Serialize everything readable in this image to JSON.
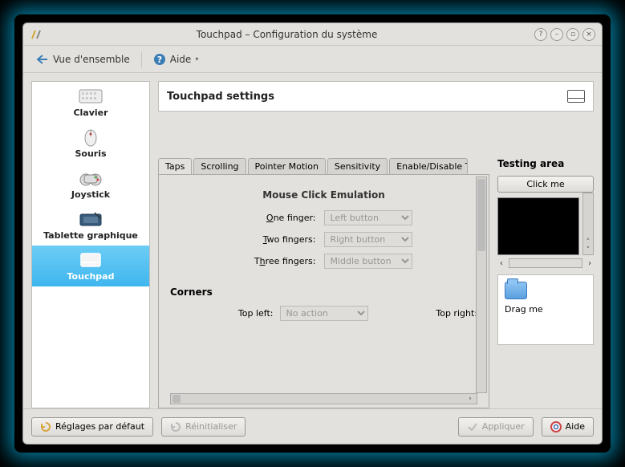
{
  "window": {
    "title": "Touchpad – Configuration du système"
  },
  "toolbar": {
    "overview": "Vue d'ensemble",
    "help": "Aide"
  },
  "sidebar": {
    "items": [
      {
        "label": "Clavier"
      },
      {
        "label": "Souris"
      },
      {
        "label": "Joystick"
      },
      {
        "label": "Tablette graphique"
      },
      {
        "label": "Touchpad"
      }
    ]
  },
  "header": {
    "title": "Touchpad settings"
  },
  "tabs": {
    "items": [
      "Taps",
      "Scrolling",
      "Pointer Motion",
      "Sensitivity",
      "Enable/Disable Touchpad"
    ]
  },
  "emulation": {
    "title": "Mouse Click Emulation",
    "rows": [
      {
        "label": "One finger:",
        "value": "Left button"
      },
      {
        "label": "Two fingers:",
        "value": "Right button"
      },
      {
        "label": "Three fingers:",
        "value": "Middle button"
      }
    ]
  },
  "corners": {
    "title": "Corners",
    "topleft_label": "Top left:",
    "topleft_value": "No action",
    "topright_label": "Top right:"
  },
  "testing": {
    "title": "Testing area",
    "click": "Click me",
    "drag": "Drag me"
  },
  "footer": {
    "defaults": "Réglages par défaut",
    "reset": "Réinitialiser",
    "apply": "Appliquer",
    "help": "Aide"
  }
}
